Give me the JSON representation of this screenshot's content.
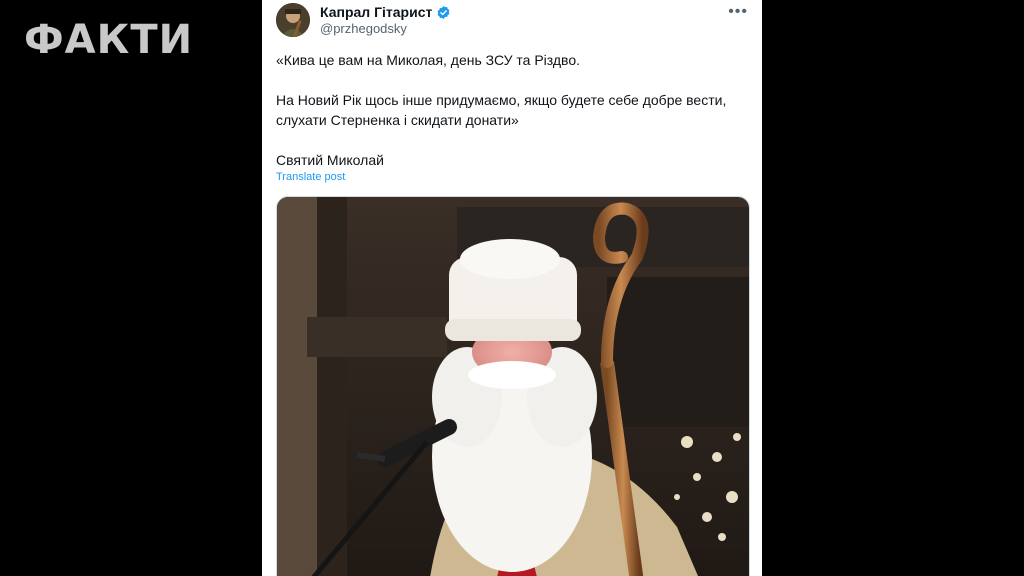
{
  "watermark": {
    "logo_text": "ФАКТИ"
  },
  "tweet": {
    "display_name": "Капрал Гітарист",
    "handle": "@przhegodsky",
    "verified": true,
    "more_icon": "•••",
    "text": {
      "p1": "«Кива це вам на Миколая, день ЗСУ та Різдво.",
      "p2": "На Новий Рік щось інше придумаємо, якщо будете себе добре вести, слухати Стерненка і скидати донати»",
      "p3": "Святий Миколай"
    },
    "translate_label": "Translate post"
  },
  "colors": {
    "background": "#000000",
    "card": "#ffffff",
    "link": "#1d9bf0",
    "text": "#0f1419",
    "muted": "#536471",
    "verified": "#1d9bf0"
  },
  "icons": {
    "verified": "verified-badge-icon",
    "more": "more-options-icon"
  }
}
